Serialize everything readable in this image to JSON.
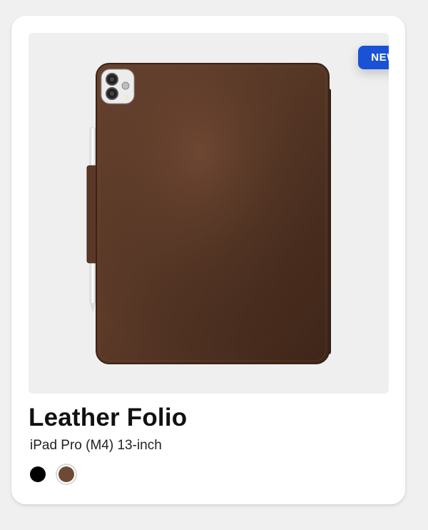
{
  "product": {
    "badge": "NEW",
    "title": "Leather Folio",
    "subtitle": "iPad Pro (M4) 13-inch",
    "image_alt": "Brown leather folio case for iPad Pro, back view",
    "swatches": [
      {
        "name": "Black",
        "color": "#000000",
        "selected": false
      },
      {
        "name": "Brown",
        "color": "#6e4a35",
        "selected": true
      }
    ]
  },
  "colors": {
    "badge_bg": "#1a52d6",
    "leather": "#5b3a28",
    "card_bg": "#ffffff",
    "page_bg": "#f0f0f1"
  }
}
